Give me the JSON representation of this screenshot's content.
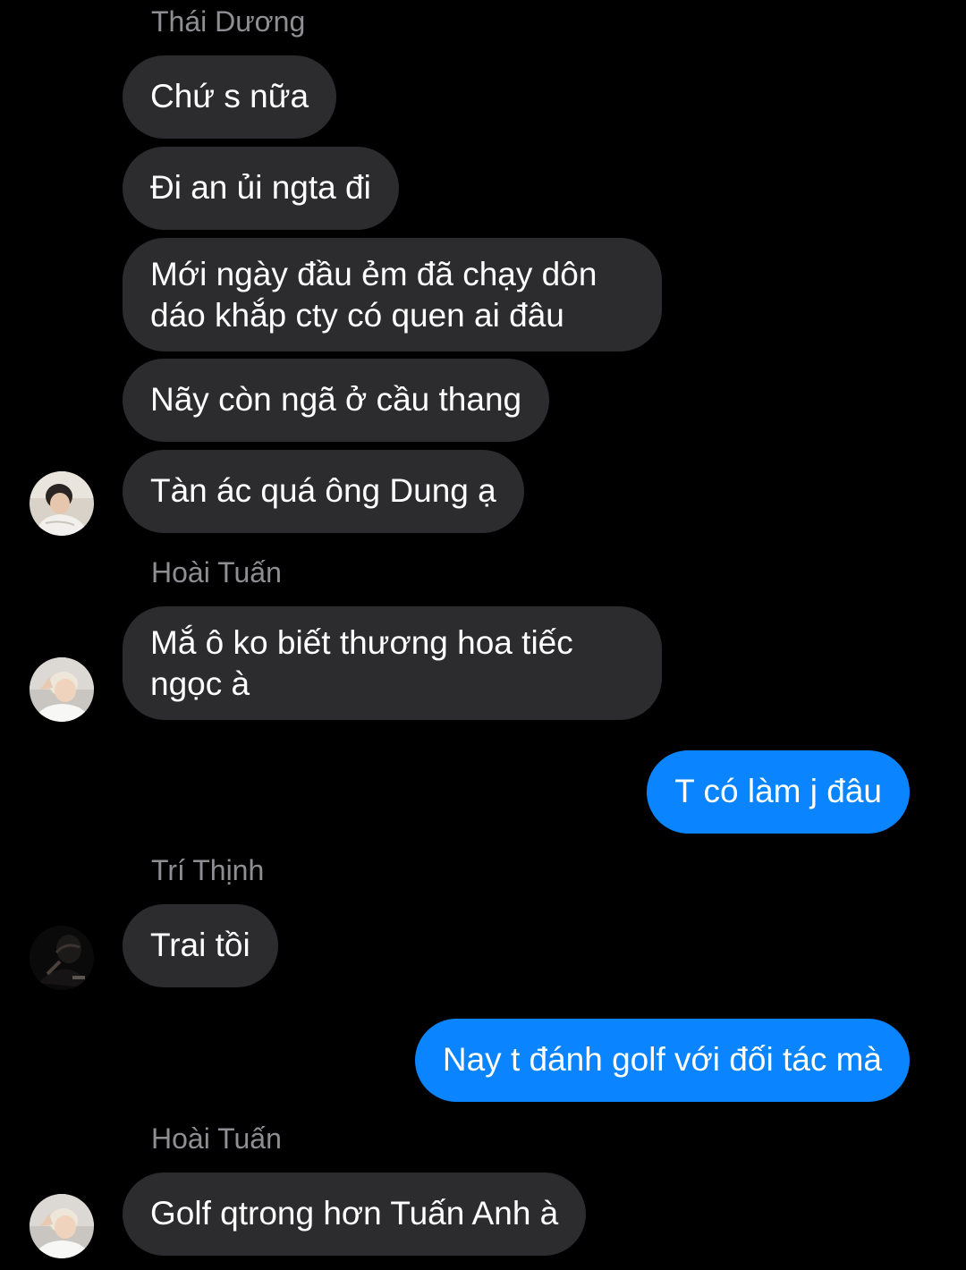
{
  "conversation": {
    "messages": [
      {
        "sender": "Thái Dương"
      },
      {
        "text": "Chứ s nữa"
      },
      {
        "text": "Đi an ủi ngta đi"
      },
      {
        "text_line1": "Mới ngày đầu ẻm đã chạy dôn",
        "text_line2": "dáo khắp cty có quen ai đâu"
      },
      {
        "text": "Nãy còn ngã ở cầu thang"
      },
      {
        "text": "Tàn ác quá ông Dung ạ"
      },
      {
        "sender": "Hoài Tuấn"
      },
      {
        "text_line1": "Mắ ô ko biết thương hoa tiếc",
        "text_line2": "ngọc à"
      },
      {
        "text": "T có làm j đâu"
      },
      {
        "sender": "Trí Thịnh"
      },
      {
        "text": "Trai tồi"
      },
      {
        "text": "Nay t đánh golf với đối tác mà"
      },
      {
        "sender": "Hoài Tuấn"
      },
      {
        "text": "Golf qtrong hơn Tuấn Anh à"
      }
    ]
  },
  "colors": {
    "background": "#000000",
    "incoming_bubble": "#2c2c2e",
    "outgoing_bubble": "#0a84ff",
    "sender_name": "#8e8e93",
    "text": "#ffffff"
  }
}
